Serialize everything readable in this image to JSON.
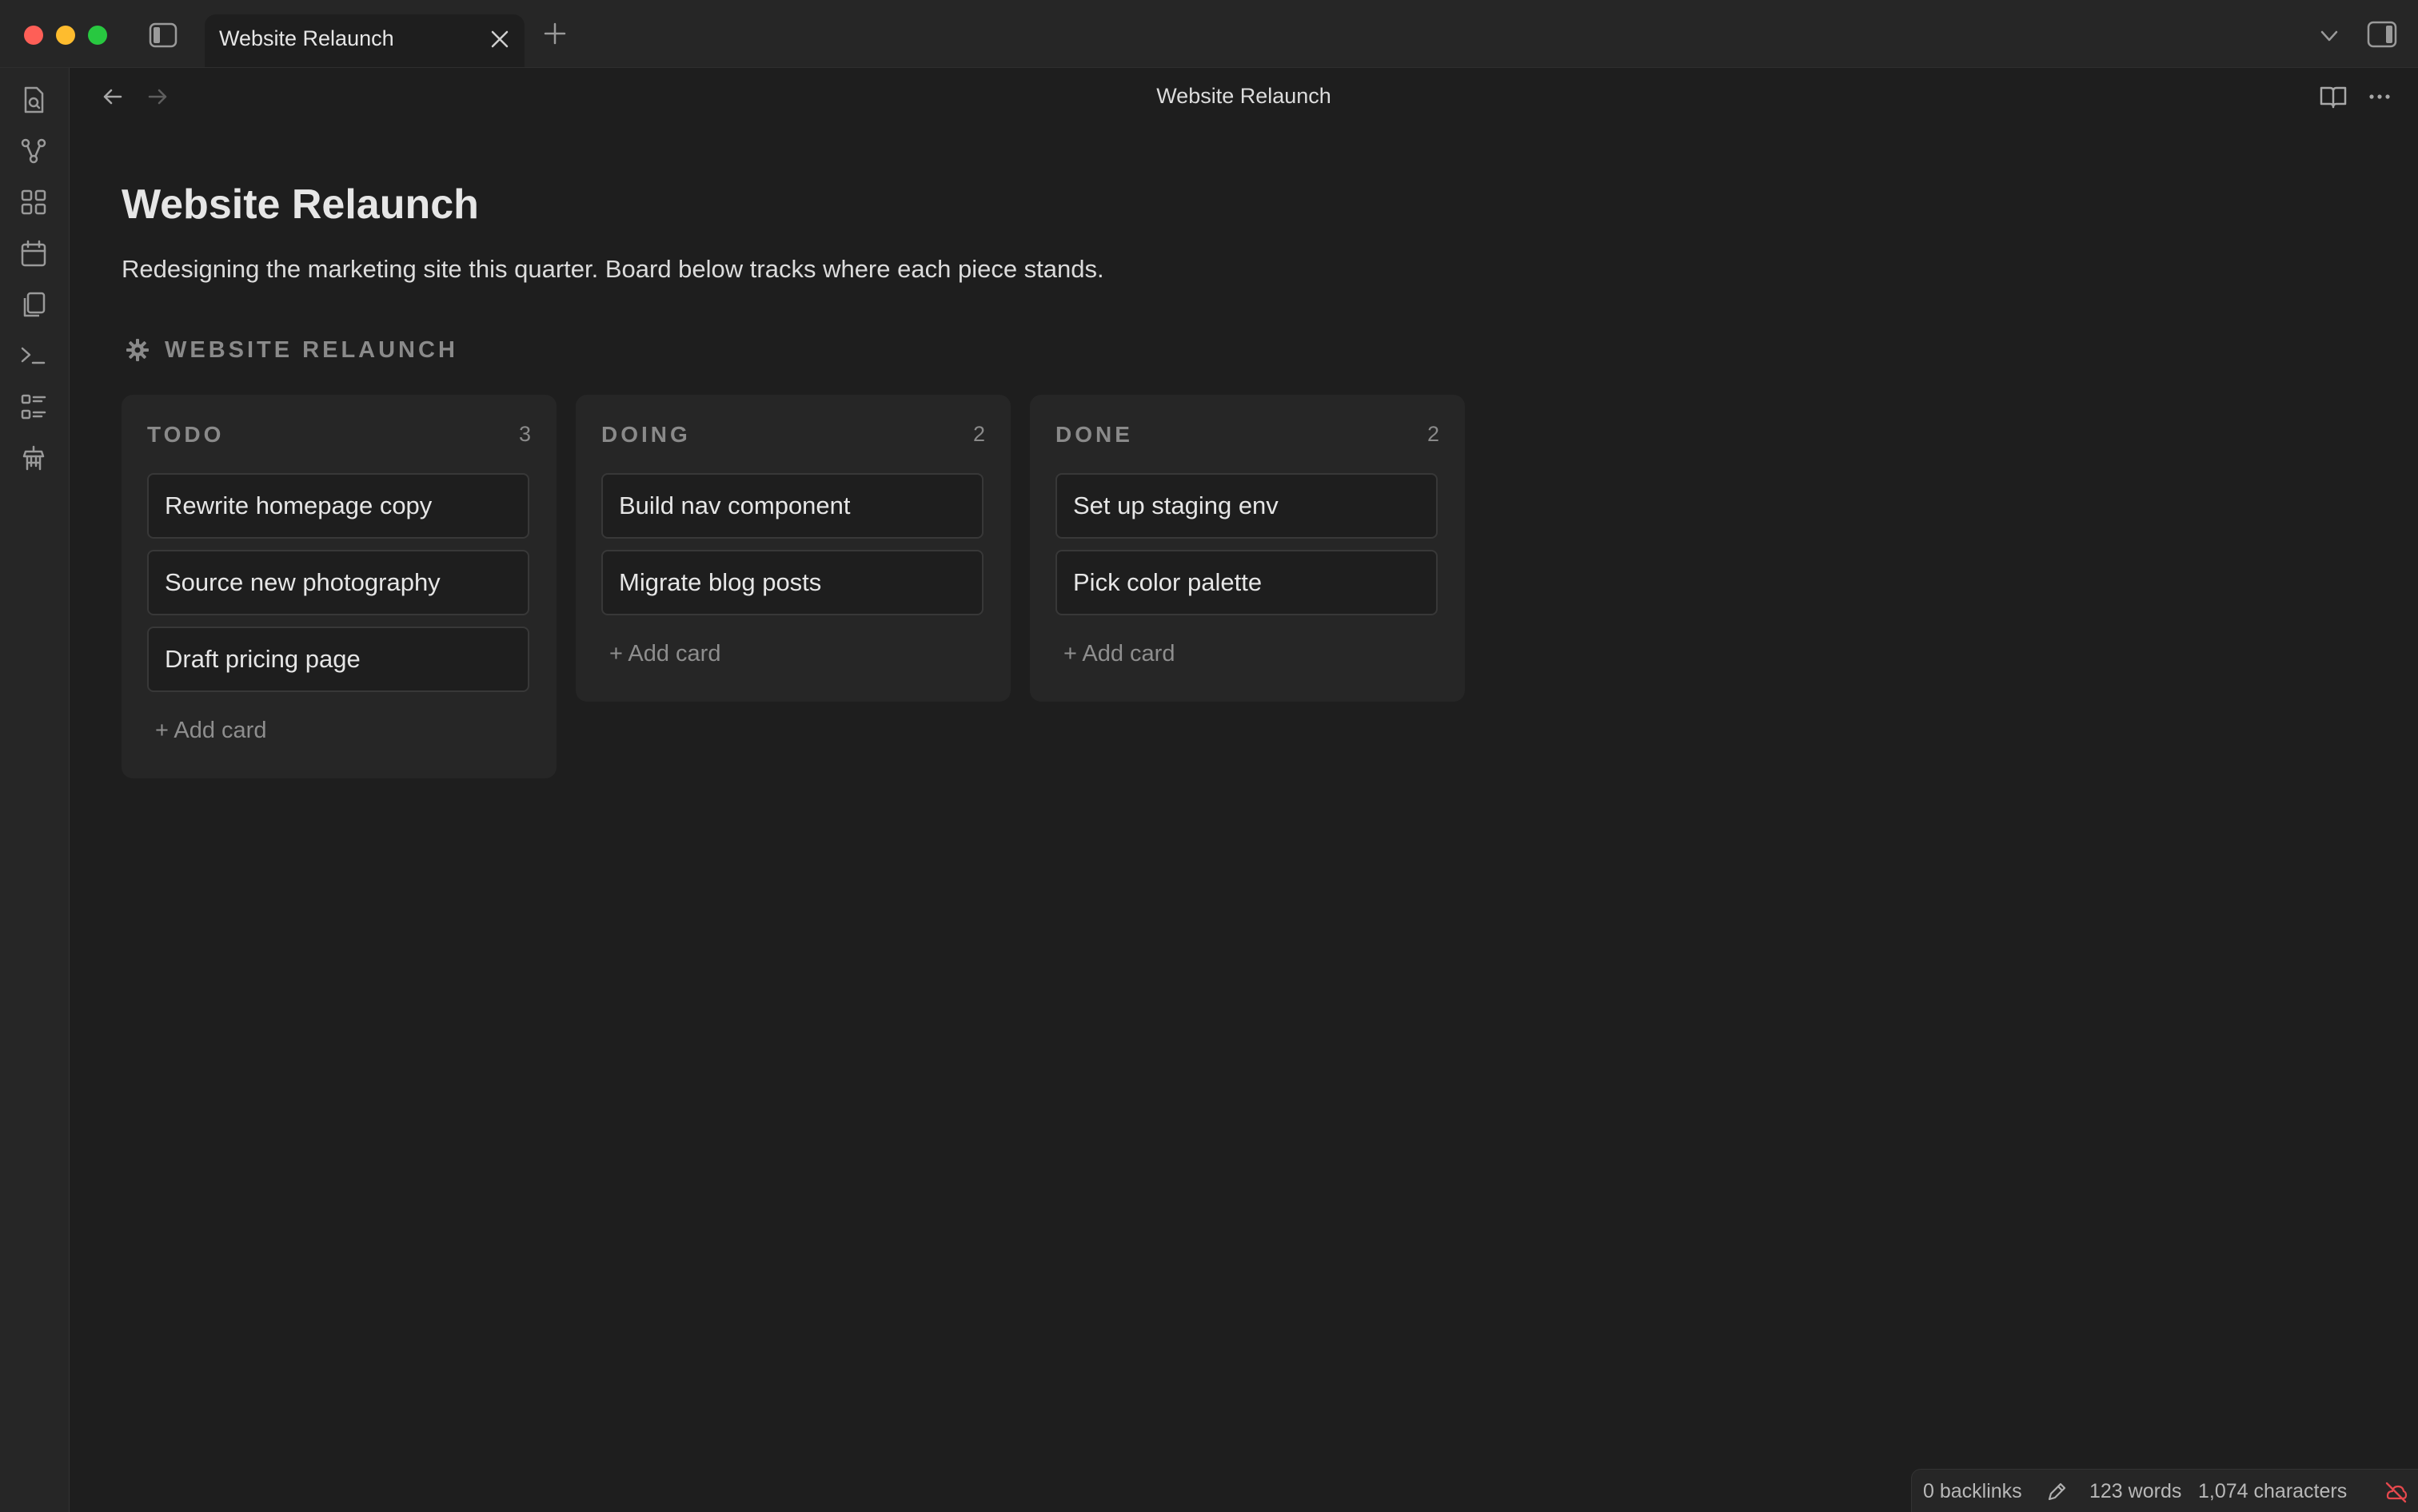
{
  "tab": {
    "title": "Website Relaunch"
  },
  "header": {
    "title": "Website Relaunch"
  },
  "note": {
    "title": "Website Relaunch",
    "description": "Redesigning the marketing site this quarter. Board below tracks where each piece stands."
  },
  "board": {
    "title": "WEBSITE RELAUNCH",
    "lanes": [
      {
        "name": "TODO",
        "count": "3",
        "cards": [
          "Rewrite homepage copy",
          "Source new photography",
          "Draft pricing page"
        ],
        "add_label": "+ Add card"
      },
      {
        "name": "DOING",
        "count": "2",
        "cards": [
          "Build nav component",
          "Migrate blog posts"
        ],
        "add_label": "+ Add card"
      },
      {
        "name": "DONE",
        "count": "2",
        "cards": [
          "Set up staging env",
          "Pick color palette"
        ],
        "add_label": "+ Add card"
      }
    ]
  },
  "status": {
    "backlinks": "0 backlinks",
    "words": "123 words",
    "characters": "1,074 characters"
  },
  "ribbon_icons": [
    "file-search-icon",
    "graph-icon",
    "grid-icon",
    "calendar-icon",
    "copy-icon",
    "terminal-icon",
    "list-grid-icon",
    "bot-icon"
  ],
  "colors": {
    "window_bg": "#1e1e1e",
    "chrome_bg": "#262626",
    "sync_error": "#e5484d"
  }
}
